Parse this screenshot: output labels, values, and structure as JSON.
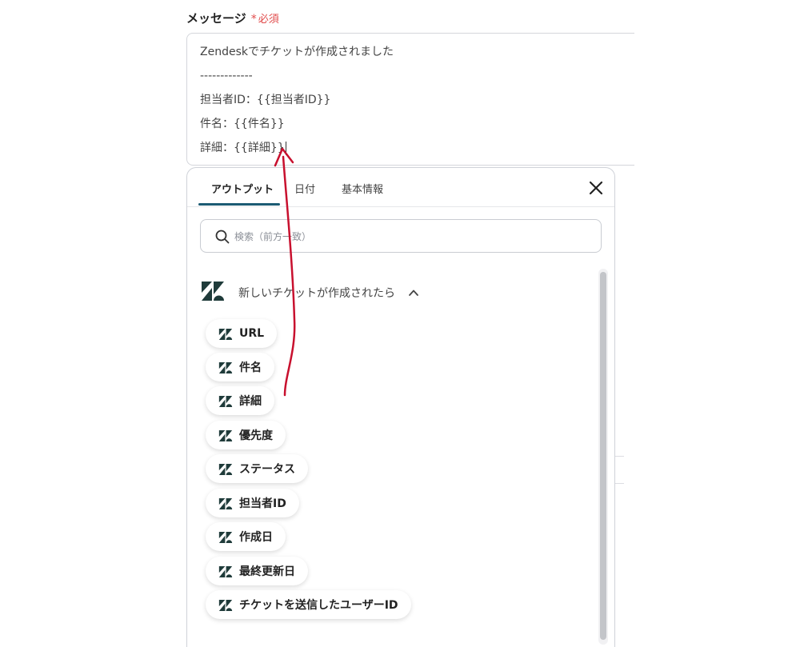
{
  "field": {
    "label": "メッセージ",
    "required_mark": "*",
    "required_text": "必須"
  },
  "message": {
    "lines": [
      "Zendeskでチケットが作成されました",
      "-------------",
      "担当者ID：{{担当者ID}}",
      "件名：{{件名}}",
      "詳細：{{詳細}}"
    ]
  },
  "panel": {
    "tabs": [
      {
        "label": "アウトプット",
        "active": true
      },
      {
        "label": "日付",
        "active": false
      },
      {
        "label": "基本情報",
        "active": false
      }
    ],
    "close_icon": "close-icon",
    "search": {
      "placeholder": "検索（前方一致）",
      "value": "",
      "icon": "search-icon"
    },
    "section": {
      "title": "新しいチケットが作成されたら",
      "icon": "zendesk-logo-icon",
      "expanded": true
    },
    "items": [
      {
        "label": "URL"
      },
      {
        "label": "件名"
      },
      {
        "label": "詳細"
      },
      {
        "label": "優先度"
      },
      {
        "label": "ステータス"
      },
      {
        "label": "担当者ID"
      },
      {
        "label": "作成日"
      },
      {
        "label": "最終更新日"
      },
      {
        "label": "チケットを送信したユーザーID"
      }
    ]
  },
  "colors": {
    "required": "#e14b4b",
    "tab_underline": "#1c5b73",
    "zendesk_logo": "#1f3b3a",
    "annotation_arrow": "#c8102e"
  }
}
